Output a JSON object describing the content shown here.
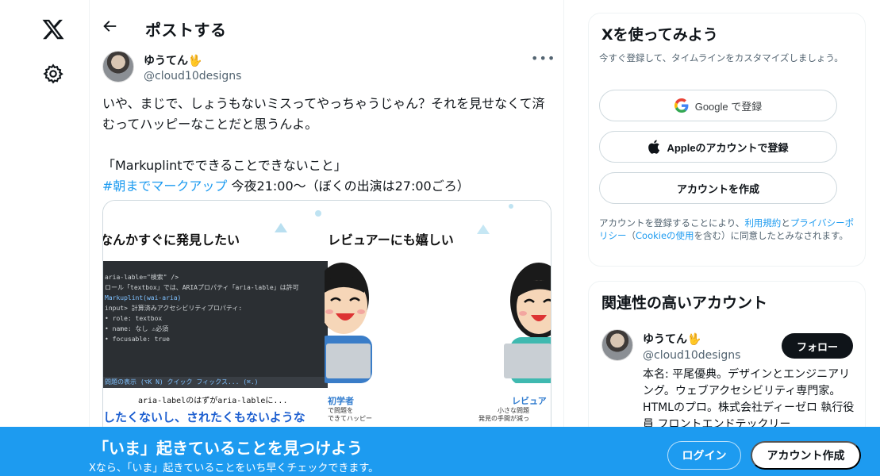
{
  "nav": {
    "logo_icon": "x-logo-icon",
    "settings_icon": "gear-icon"
  },
  "header": {
    "back_icon": "arrow-left-icon",
    "title": "ポストする"
  },
  "post": {
    "author_name": "ゆうてん🖖",
    "author_handle": "@cloud10designs",
    "more_icon": "more-horizontal-icon",
    "text_line1": "いや、まじで、しょうもないミスってやっちゃうじゃん？それを見せなくて済むってハッピーなことだと思うんよ。",
    "text_line2": "「Markuplintでできることできないこと」",
    "hashtag": "#朝までマークアップ",
    "text_line3": " 今夜21:00〜（ぼくの出演は27:00ごろ）",
    "media": {
      "left_heading": "なんかすぐに発見したい",
      "right_heading": "レビュアーにも嬉しい",
      "code_lines": [
        "aria-lable=\"検索\" />",
        "ロール「textbox」では、ARIAプロパティ「aria-lable」は許可",
        "Markuplint(wai-aria)",
        "input> 計算済みアクセシビリティプロパティ:",
        "• role: textbox",
        "• name: なし ⚠必須",
        "• focusable: true"
      ],
      "code_footer": "問題の表示 (⌥K N)   クイック フィックス... (⌘.)",
      "caption_small": "aria-labelのはずがaria-lableに...",
      "caption_big": "したくないし、されたくもないような",
      "role_left": "初学者",
      "role_left_sub": "で問題を\nできてハッピー",
      "role_right": "レビュア",
      "role_right_sub": "小さな問題\n発見の手間が減っ"
    }
  },
  "signup_card": {
    "title": "Xを使ってみよう",
    "description": "今すぐ登録して、タイムラインをカスタマイズしましょう。",
    "google_label": "Google で登録",
    "apple_label": "Appleのアカウントで登録",
    "create_label": "アカウントを作成",
    "terms_prefix": "アカウントを登録することにより、",
    "terms_link": "利用規約",
    "terms_and": "と",
    "privacy_link": "プライバシーポリシー",
    "cookie_open": "（",
    "cookie_link": "Cookieの使用",
    "cookie_close": "を含む）に同意したとみなされます。"
  },
  "related_card": {
    "title": "関連性の高いアカウント",
    "name": "ゆうてん🖖",
    "handle": "@cloud10designs",
    "follow_label": "フォロー",
    "bio": "本名: 平尾優典。デザインとエンジニアリング。ウェブアクセシビリティ専門家。HTMLのプロ。株式会社ディーゼロ 執行役員 フロントエンドテックリー"
  },
  "banner": {
    "title": "「いま」起きていることを見つけよう",
    "subtitle": "Xなら、「いま」起きていることをいち早くチェックできます。",
    "login_label": "ログイン",
    "signup_label": "アカウント作成"
  },
  "colors": {
    "accent": "#1d9bf0",
    "text": "#0f1419",
    "muted": "#536471"
  }
}
